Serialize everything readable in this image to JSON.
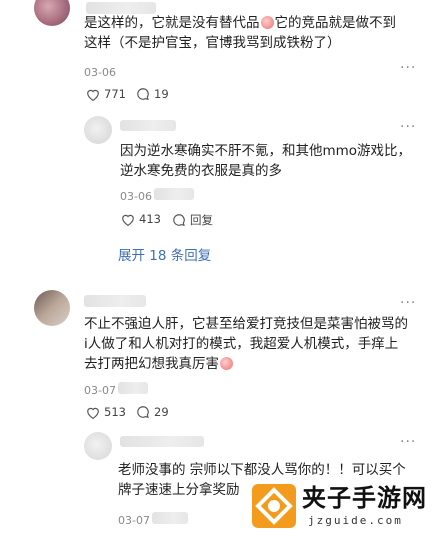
{
  "comments": [
    {
      "text_lines": [
        "是这样的，它就是没有替代品",
        "它的竞品就是做不到",
        "这样（不是护官宝，官博我骂到成铁粉了）"
      ],
      "date": "03-06",
      "likes": "771",
      "replies": "19"
    },
    {
      "text_lines": [
        "因为逆水寒确实不肝不氪，和其他mmo游戏比，",
        "逆水寒免费的衣服是真的多"
      ],
      "date": "03-06",
      "likes": "413",
      "reply_label": "回复",
      "expand_label": "展开 18 条回复"
    },
    {
      "text_lines": [
        "不止不强迫人肝，它甚至给爱打竞技但是菜害怕被骂的",
        "i人做了和人机对打的模式，我超爱人机模式，手痒上",
        "去打两把幻想我真厉害"
      ],
      "date": "03-07",
      "likes": "513",
      "replies": "29"
    },
    {
      "text_lines": [
        "老师没事的 宗师以下都没人骂你的！！可以买个",
        "牌子速速上分拿奖励"
      ],
      "date": "03-07"
    }
  ],
  "more_label": "···",
  "watermark": {
    "title": "夹子手游网",
    "domain": "jzguide.com"
  },
  "colors": {
    "link": "#3f6fb5",
    "date": "#8a8a8a",
    "watermark_orange": "#f39b1c"
  }
}
